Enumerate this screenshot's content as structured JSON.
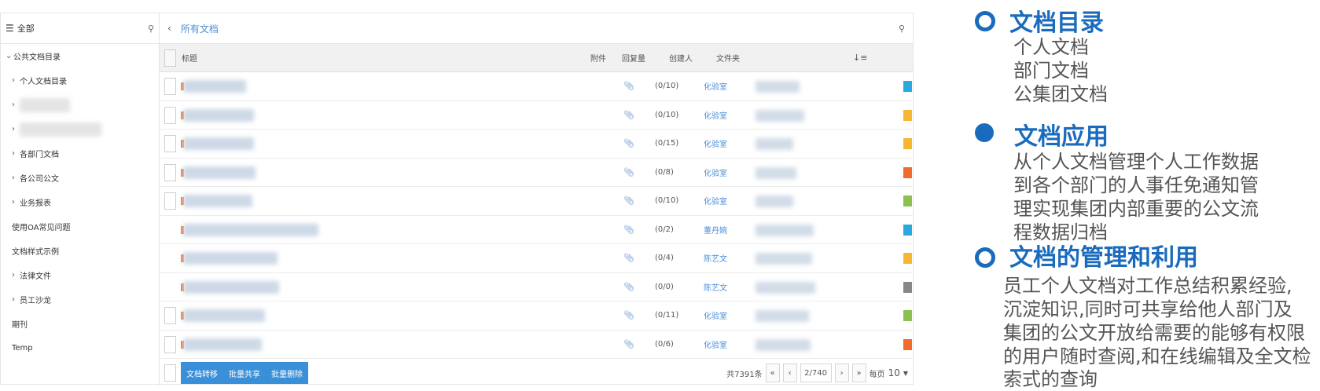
{
  "tree": {
    "header": "全部",
    "items": [
      {
        "label": "公共文档目录",
        "chev": "expanded",
        "indent": 6
      },
      {
        "label": "个人文档目录",
        "chev": "collapsed",
        "indent": 14
      },
      {
        "label": "",
        "chev": "blur",
        "indent": 14,
        "blur": 64
      },
      {
        "label": "",
        "chev": "blur",
        "indent": 14,
        "blur": 104
      },
      {
        "label": "各部门文档",
        "chev": "collapsed",
        "indent": 14
      },
      {
        "label": "各公司公文",
        "chev": "collapsed",
        "indent": 14
      },
      {
        "label": "业务报表",
        "chev": "collapsed",
        "indent": 14
      },
      {
        "label": "使用OA常见问题",
        "chev": "none",
        "indent": 14
      },
      {
        "label": "文档样式示例",
        "chev": "none",
        "indent": 14
      },
      {
        "label": "法律文件",
        "chev": "collapsed",
        "indent": 14
      },
      {
        "label": "员工沙龙",
        "chev": "collapsed",
        "indent": 14
      },
      {
        "label": "期刊",
        "chev": "none",
        "indent": 14
      },
      {
        "label": "Temp",
        "chev": "none",
        "indent": 14
      }
    ]
  },
  "breadcrumb": "所有文档",
  "table": {
    "headers": {
      "title": "标题",
      "attachment": "附件",
      "replies": "回复量",
      "creator": "创建人",
      "folder": "文件夹"
    },
    "rows": [
      {
        "replies": "(0/10)",
        "creator": "化验室",
        "color": "#2aa9e0",
        "chk": true,
        "tw": 80,
        "fw": 56
      },
      {
        "replies": "(0/10)",
        "creator": "化验室",
        "color": "#f6b733",
        "chk": true,
        "tw": 90,
        "fw": 62
      },
      {
        "replies": "(0/15)",
        "creator": "化验室",
        "color": "#f6b733",
        "chk": true,
        "tw": 90,
        "fw": 48
      },
      {
        "replies": "(0/8)",
        "creator": "化验室",
        "color": "#f06b2c",
        "chk": true,
        "tw": 92,
        "fw": 52
      },
      {
        "replies": "(0/10)",
        "creator": "化验室",
        "color": "#8cc152",
        "chk": true,
        "tw": 88,
        "fw": 48
      },
      {
        "replies": "(0/2)",
        "creator": "董丹婉",
        "color": "#2aa9e0",
        "chk": false,
        "tw": 172,
        "fw": 74
      },
      {
        "replies": "(0/4)",
        "creator": "陈艺文",
        "color": "#f6b733",
        "chk": false,
        "tw": 120,
        "fw": 72
      },
      {
        "replies": "(0/0)",
        "creator": "陈艺文",
        "color": "#888888",
        "chk": false,
        "tw": 122,
        "fw": 76
      },
      {
        "replies": "(0/11)",
        "creator": "化验室",
        "color": "#8cc152",
        "chk": true,
        "tw": 104,
        "fw": 68
      },
      {
        "replies": "(0/6)",
        "creator": "化验室",
        "color": "#f06b2c",
        "chk": true,
        "tw": 100,
        "fw": 70
      }
    ]
  },
  "footer": {
    "buttons": [
      "文档转移",
      "批量共享",
      "批量删除"
    ],
    "total": "共7391条",
    "first": "«",
    "prev": "‹",
    "page": "2/740",
    "next": "›",
    "last": "»",
    "per_page_label": "每页",
    "per_page": "10"
  },
  "notes": {
    "s1": {
      "title": "文档目录",
      "lines": [
        "个人文档",
        " 部门文档",
        " 公集团文档"
      ]
    },
    "s2": {
      "title": "文档应用",
      "lines": [
        "从个人文档管理个人工作数据",
        "到各个部门的人事任免通知管",
        "理实现集团内部重要的公文流",
        "程数据归档"
      ]
    },
    "s3": {
      "title": "文档的管理和利用",
      "lines": [
        "员工个人文档对工作总结积累经验,",
        "沉淀知识,同时可共享给他人部门及",
        "集团的公文开放给需要的能够有权限",
        "的用户随时查阅,和在线编辑及全文检",
        "索式的查询"
      ]
    }
  },
  "colors": {
    "accent": "#1a6bbd",
    "link": "#4a8ed6",
    "button": "#3a8fd9"
  }
}
